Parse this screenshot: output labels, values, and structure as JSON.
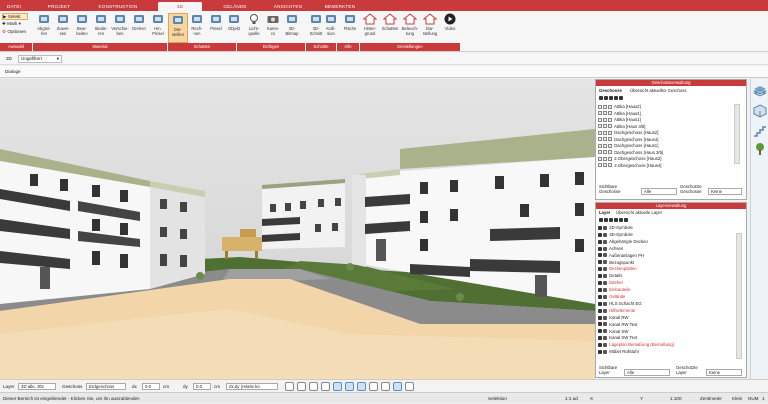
{
  "tabs": [
    "DATEI",
    "PROJEKT",
    "KONSTRUKTION",
    "3D",
    "GELÄNDE",
    "ANSICHTEN",
    "BEMERKTEN"
  ],
  "ribbon_left": {
    "select": "Selekt",
    "mark": "Mark",
    "options": "Optionen",
    "group": "Auswahl"
  },
  "ribbon_buttons": [
    {
      "label": "Abgrei-\nfen",
      "icon": "eyedropper-icon"
    },
    {
      "label": "Zuwei-\nsen",
      "icon": "brush-icon"
    },
    {
      "label": "Bear-\nbeiten",
      "icon": "edit-icon"
    },
    {
      "label": "Skalie-\nren",
      "icon": "scale-icon"
    },
    {
      "label": "Verschie-\nben",
      "icon": "move-icon"
    },
    {
      "label": "Drehen",
      "icon": "rotate-icon"
    },
    {
      "label": "Hin.\nPinsel",
      "icon": "pencil-icon"
    },
    {
      "label": "Dar-\nstellen",
      "icon": "render-icon"
    },
    {
      "label": "Rech-\nnen",
      "icon": "shadow-icon"
    },
    {
      "label": "Pinsel",
      "icon": "paint-icon"
    },
    {
      "label": "Objekt",
      "icon": "chair-icon"
    },
    {
      "label": "Licht-\nquelle",
      "icon": "bulb-icon"
    },
    {
      "label": "Kame-\nra",
      "icon": "camera-icon"
    },
    {
      "label": "3D-\nBitmap",
      "icon": "image-icon"
    },
    {
      "label": "3D-\nSchnitt",
      "icon": "cut-icon"
    },
    {
      "label": "Kolli-\nsion",
      "icon": "collision-icon"
    },
    {
      "label": "Fläche",
      "icon": "area-icon"
    },
    {
      "label": "Hinter-\ngrund",
      "icon": "house-icon"
    },
    {
      "label": "Schatten",
      "icon": "house-icon"
    },
    {
      "label": "Beleuch-\ntung",
      "icon": "house-icon"
    },
    {
      "label": "Dar-\nstellung",
      "icon": "house-icon"
    },
    {
      "label": "Video",
      "icon": "play-icon"
    }
  ],
  "ribbon_groups": [
    "Material",
    "Schatten",
    "Einfügen",
    "Schnitte",
    "Info",
    "Einstellungen"
  ],
  "toolrow": {
    "view": "3D",
    "mode": "Ungefiltert"
  },
  "dialogbar": {
    "label": "Dialoge"
  },
  "floors_panel": {
    "title": "Geschossverwaltung",
    "tabs": [
      "Geschosse",
      "Übersicht aktuelles Geschoss"
    ],
    "rows": [
      "Attika [Haus2]",
      "Attika [Haus4]",
      "Attika [Haus1]",
      "Attika [Haus 3/5]",
      "Dachgeschoss [Haus2]",
      "Dachgeschoss [Haus4]",
      "Dachgeschoss [Haus1]",
      "Dachgeschoss [Haus 3/5]",
      "2.Obergeschoss [Haus2]",
      "2.Obergeschoss [Haus4]"
    ],
    "footer_visible": "Sichtbare Geschosse",
    "footer_visible_value": "Alle",
    "footer_protected": "Geschützte Geschosse",
    "footer_protected_value": "Keine"
  },
  "layers_panel": {
    "title": "Layerverwaltung",
    "tabs": [
      "Layer",
      "Übersicht aktuelle Layer"
    ],
    "rows": [
      {
        "name": "2D-Symbole",
        "color": "#222222"
      },
      {
        "name": "3D-Symbole",
        "color": "#222222"
      },
      {
        "name": "Abgehängte Decken",
        "color": "#222222"
      },
      {
        "name": "Achsen",
        "color": "#222222"
      },
      {
        "name": "Außenanlagen PH",
        "color": "#222222"
      },
      {
        "name": "Bezugspunkt",
        "color": "#222222"
      },
      {
        "name": "Deckenplatten",
        "color": "#d03030"
      },
      {
        "name": "Details",
        "color": "#222222"
      },
      {
        "name": "Dächer",
        "color": "#d03030"
      },
      {
        "name": "Einbauteile",
        "color": "#d03030"
      },
      {
        "name": "Gelände",
        "color": "#d03030"
      },
      {
        "name": "HLS Schacht EG",
        "color": "#222222"
      },
      {
        "name": "Hilfselemente",
        "color": "#d03030"
      },
      {
        "name": "Kanal RW",
        "color": "#222222"
      },
      {
        "name": "Kanal RW Text",
        "color": "#222222"
      },
      {
        "name": "Kanal SW",
        "color": "#222222"
      },
      {
        "name": "Kanal SW Text",
        "color": "#222222"
      },
      {
        "name": "Lageplan Bemaßung (Bemaßung)",
        "color": "#d03030"
      },
      {
        "name": "Möbel Rollstuhl",
        "color": "#222222"
      }
    ],
    "footer_visible": "Sichtbare Layer",
    "footer_visible_value": "Alle",
    "footer_protected": "Geschützte Layer",
    "footer_protected_value": "Keine"
  },
  "bottombar": {
    "layer_label": "Layer",
    "layer_value": "3D alle, 30c",
    "geschoss_label": "Geschoss",
    "geschoss_value": "Erdgeschoss",
    "dx_label": "dx",
    "dx_value": "0.0",
    "dx_unit": "cm",
    "dy_label": "dy",
    "dy_value": "0.0",
    "dy_unit": "cm",
    "mode_value": "dx,dy (relativ ko"
  },
  "statusbar": {
    "message": "Dieser Bereich ist eingeblendet - Klicken Sie, um ihn auszublenden",
    "selection": "Selektion",
    "scale": "1:1 ad",
    "x": "X",
    "y": "Y",
    "ratio": "1:100",
    "unit": "Zentimeter",
    "caps": "Klein",
    "num": "NUM",
    "grid": "1"
  },
  "colors": {
    "accent": "#c83a3c",
    "sky": "#d9d9d9",
    "grass": "#4f6f33",
    "ground": "#f2d6aa"
  }
}
